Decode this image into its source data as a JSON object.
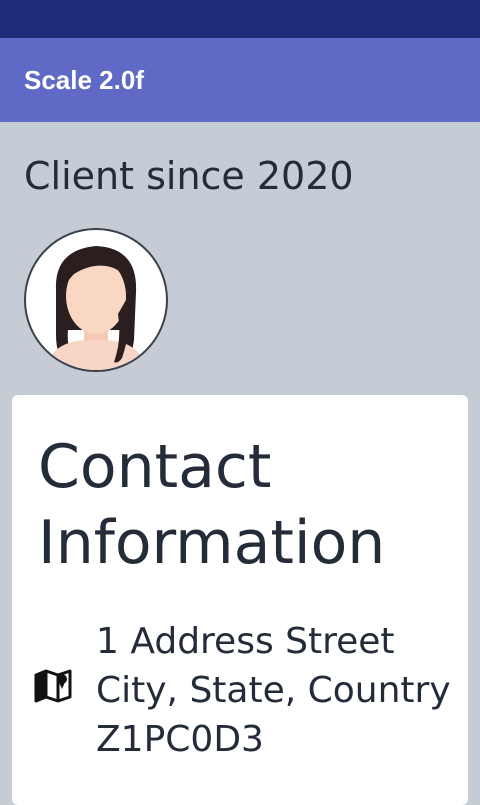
{
  "app_bar": {
    "title": "Scale 2.0f"
  },
  "profile": {
    "client_since": "Client since 2020",
    "avatar_icon": "female-avatar-icon"
  },
  "contact_card": {
    "title": "Contact Information",
    "address": {
      "icon": "map-icon",
      "line1": "1 Address Street",
      "line2": "City, State, Country",
      "line3": "Z1PC0D3"
    }
  },
  "colors": {
    "status_bar": "#1f2d78",
    "app_bar": "#5f69c6",
    "background": "#c5ccd6",
    "card": "#ffffff",
    "text": "#242c3a"
  }
}
